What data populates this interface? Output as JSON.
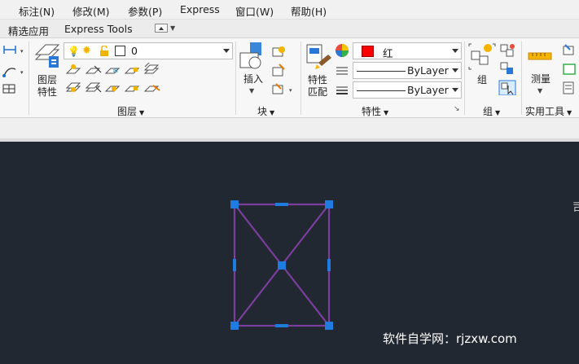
{
  "menubar": {
    "items": [
      "标注(N)",
      "修改(M)",
      "参数(P)",
      "Express",
      "窗口(W)",
      "帮助(H)"
    ]
  },
  "tabs": {
    "items": [
      "精选应用",
      "Express Tools"
    ]
  },
  "ribbon": {
    "layers_panel": {
      "label": "图层",
      "layer_button_line1": "图层",
      "layer_button_line2": "特性",
      "current_layer": "0"
    },
    "block_panel": {
      "label": "块",
      "insert_label": "插入"
    },
    "properties_panel": {
      "label": "特性",
      "match_line1": "特性",
      "match_line2": "匹配",
      "color_value": "红",
      "color_hex": "#ff0000",
      "linetype_value": "ByLayer",
      "lineweight_value": "ByLayer"
    },
    "groups_panel": {
      "label": "组",
      "group_label": "组"
    },
    "utilities_panel": {
      "label": "实用工具",
      "measure_label": "测量"
    }
  },
  "canvas": {
    "background": "#222831",
    "shape_color": "#7a3e9c",
    "grip_color": "#1e7be0",
    "watermark": "软件自学网：rjzxw.com",
    "edge_text": "司"
  }
}
